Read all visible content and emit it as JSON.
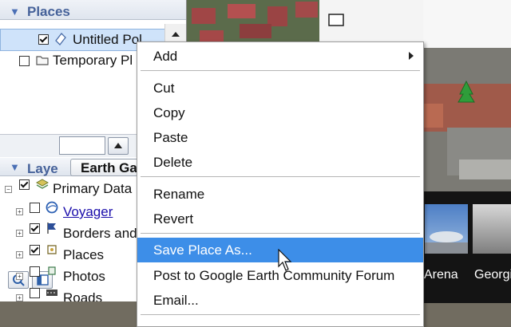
{
  "sidebar": {
    "places_header": "Places",
    "places_items": [
      {
        "label": "Untitled Pol",
        "checked": true,
        "icon": "polygon-icon"
      },
      {
        "label": "Temporary Pl",
        "checked": false,
        "icon": "folder-icon"
      }
    ],
    "layers_header": "Laye",
    "layers_tab": "Earth Ga",
    "layers_items": [
      {
        "label": "Primary Data",
        "checked": true,
        "icon": "layers-icon"
      },
      {
        "label": "Voyager",
        "checked": false,
        "icon": "globe-icon",
        "link": true
      },
      {
        "label": "Borders and",
        "checked": true,
        "icon": "flag-icon"
      },
      {
        "label": "Places",
        "checked": true,
        "icon": "places-icon"
      },
      {
        "label": "Photos",
        "checked": false,
        "icon": "photo-icon"
      },
      {
        "label": "Roads",
        "checked": false,
        "icon": "road-icon"
      }
    ]
  },
  "context_menu": {
    "items": [
      {
        "label": "Add",
        "submenu": true
      },
      {
        "label": "Cut"
      },
      {
        "label": "Copy"
      },
      {
        "label": "Paste"
      },
      {
        "label": "Delete"
      },
      {
        "label": "Rename"
      },
      {
        "label": "Revert"
      },
      {
        "label": "Save Place As...",
        "selected": true
      },
      {
        "label": "Post to Google Earth Community Forum"
      },
      {
        "label": "Email..."
      }
    ]
  },
  "thumbnails": [
    {
      "label": "Arena"
    },
    {
      "label": "Georgi"
    }
  ],
  "colors": {
    "selection": "#3d8ee8",
    "header_text": "#46629a",
    "link": "#1a0dab"
  }
}
